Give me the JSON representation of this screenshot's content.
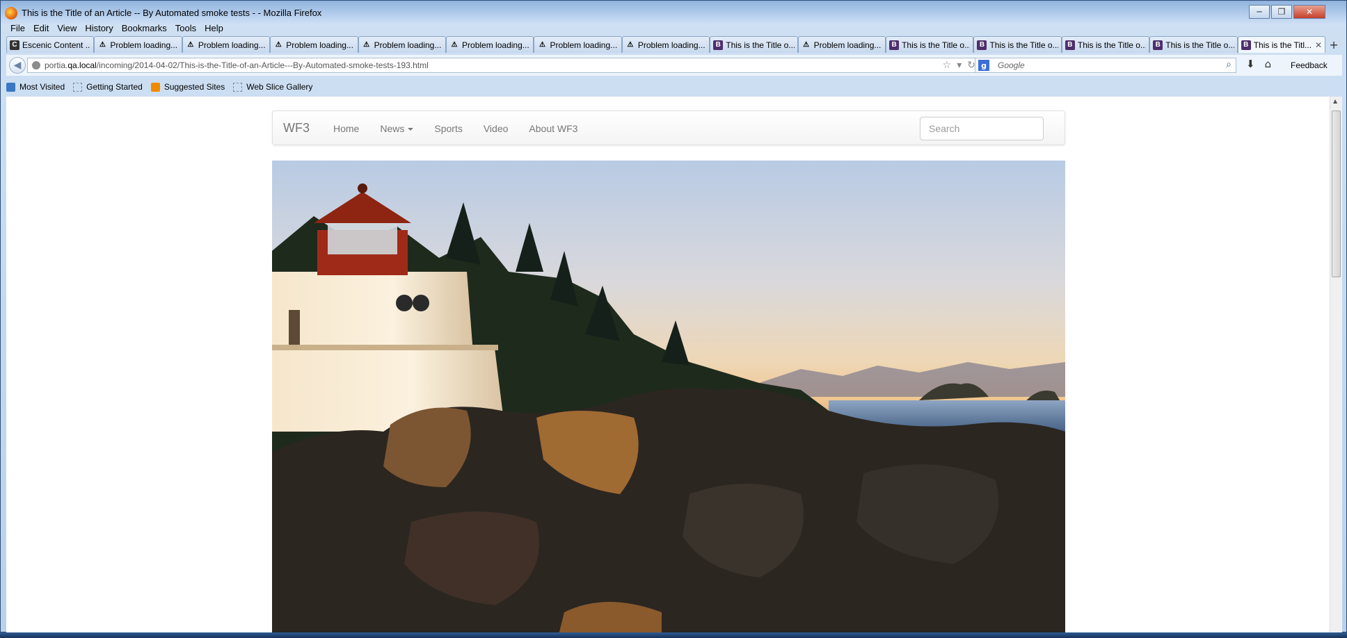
{
  "window": {
    "title": "This is the Title of an Article -- By Automated smoke tests - - Mozilla Firefox",
    "controls": {
      "minimize": "─",
      "maximize": "❐",
      "close": "✕"
    }
  },
  "menu": [
    "File",
    "Edit",
    "View",
    "History",
    "Bookmarks",
    "Tools",
    "Help"
  ],
  "tabs": [
    {
      "label": "Escenic Content ...",
      "icon": "escenic-icon"
    },
    {
      "label": "Problem loading...",
      "icon": "warning-icon"
    },
    {
      "label": "Problem loading...",
      "icon": "warning-icon"
    },
    {
      "label": "Problem loading...",
      "icon": "warning-icon"
    },
    {
      "label": "Problem loading...",
      "icon": "warning-icon"
    },
    {
      "label": "Problem loading...",
      "icon": "warning-icon"
    },
    {
      "label": "Problem loading...",
      "icon": "warning-icon"
    },
    {
      "label": "Problem loading...",
      "icon": "warning-icon"
    },
    {
      "label": "This is the Title o...",
      "icon": "bootstrap-icon"
    },
    {
      "label": "Problem loading...",
      "icon": "warning-icon"
    },
    {
      "label": "This is the Title o...",
      "icon": "bootstrap-icon"
    },
    {
      "label": "This is the Title o...",
      "icon": "bootstrap-icon"
    },
    {
      "label": "This is the Title o...",
      "icon": "bootstrap-icon"
    },
    {
      "label": "This is the Title o...",
      "icon": "bootstrap-icon"
    },
    {
      "label": "This is the Titl...",
      "icon": "bootstrap-icon",
      "active": true
    }
  ],
  "navbar": {
    "url_prefix": "portia.",
    "url_host": "qa.local",
    "url_path": "/incoming/2014-04-02/This-is-the-Title-of-an-Article---By-Automated-smoke-tests-193.html",
    "search_placeholder": "Google",
    "feedback": "Feedback"
  },
  "bookmarks": [
    "Most Visited",
    "Getting Started",
    "Suggested Sites",
    "Web Slice Gallery"
  ],
  "site": {
    "brand": "WF3",
    "nav": [
      "Home",
      "News",
      "Sports",
      "Video",
      "About WF3"
    ],
    "search_placeholder": "Search"
  },
  "hero": {
    "subject": "lighthouse-on-rocky-coast-at-sunset"
  }
}
